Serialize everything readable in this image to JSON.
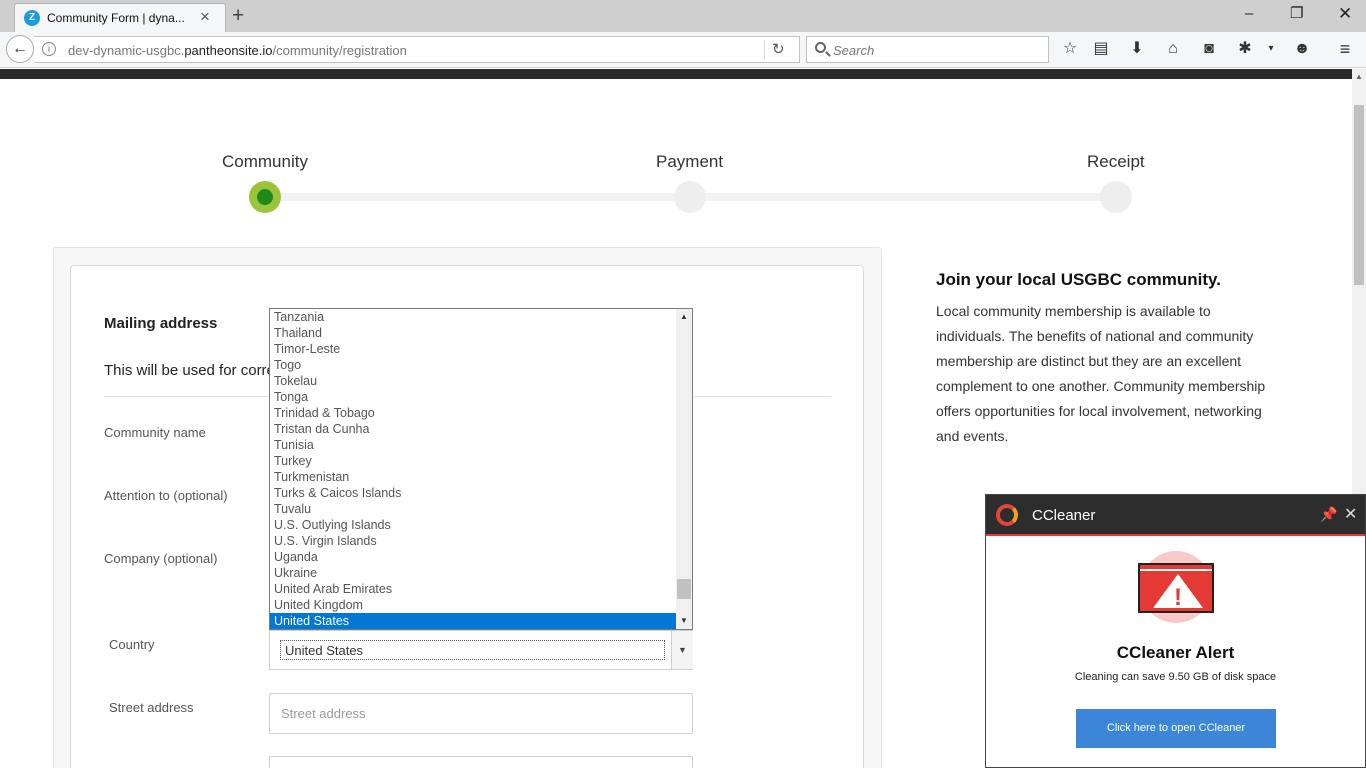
{
  "browser": {
    "tab_title": "Community Form | dyna...",
    "tab_favicon_letter": "Z",
    "url_prefix": "dev-dynamic-usgbc.",
    "url_host": "pantheonsite.io",
    "url_path": "/community/registration",
    "search_placeholder": "Search",
    "icons": [
      "back-arrow-icon",
      "info-icon",
      "reload-icon",
      "search-icon",
      "star-icon",
      "reading-list-icon",
      "download-icon",
      "home-icon",
      "pocket-icon",
      "extension-icon",
      "menu-dropdown-icon",
      "smiley-icon",
      "hamburger-menu-icon"
    ]
  },
  "steps": [
    {
      "label": "Community",
      "active": true
    },
    {
      "label": "Payment",
      "active": false
    },
    {
      "label": "Receipt",
      "active": false
    }
  ],
  "form": {
    "section_title": "Mailing address",
    "section_desc": "This will be used for corre",
    "labels": {
      "community_name": "Community name",
      "attention": "Attention to (optional)",
      "company": "Company (optional)",
      "country": "Country",
      "street": "Street address"
    },
    "country_value": "United States",
    "street_placeholder": "Street address"
  },
  "dropdown": {
    "options": [
      "Tanzania",
      "Thailand",
      "Timor-Leste",
      "Togo",
      "Tokelau",
      "Tonga",
      "Trinidad & Tobago",
      "Tristan da Cunha",
      "Tunisia",
      "Turkey",
      "Turkmenistan",
      "Turks & Caicos Islands",
      "Tuvalu",
      "U.S. Outlying Islands",
      "U.S. Virgin Islands",
      "Uganda",
      "Ukraine",
      "United Arab Emirates",
      "United Kingdom",
      "United States"
    ],
    "selected": "United States"
  },
  "info": {
    "title": "Join your local USGBC community.",
    "body": "Local community membership is available to individuals. The benefits of national and community membership are distinct but they are an excellent complement to one another. Community membership offers opportunities for local involvement, networking and events."
  },
  "ccleaner": {
    "app_name": "CCleaner",
    "alert_title": "CCleaner Alert",
    "alert_text": "Cleaning can save 9.50 GB of disk space",
    "button_label": "Click here to open CCleaner"
  },
  "colors": {
    "step_active": "#9cc43b",
    "step_active_core": "#1e8a1e",
    "selection": "#0078d7",
    "ccleaner_red": "#e53935",
    "ccleaner_button": "#3b86d8"
  }
}
